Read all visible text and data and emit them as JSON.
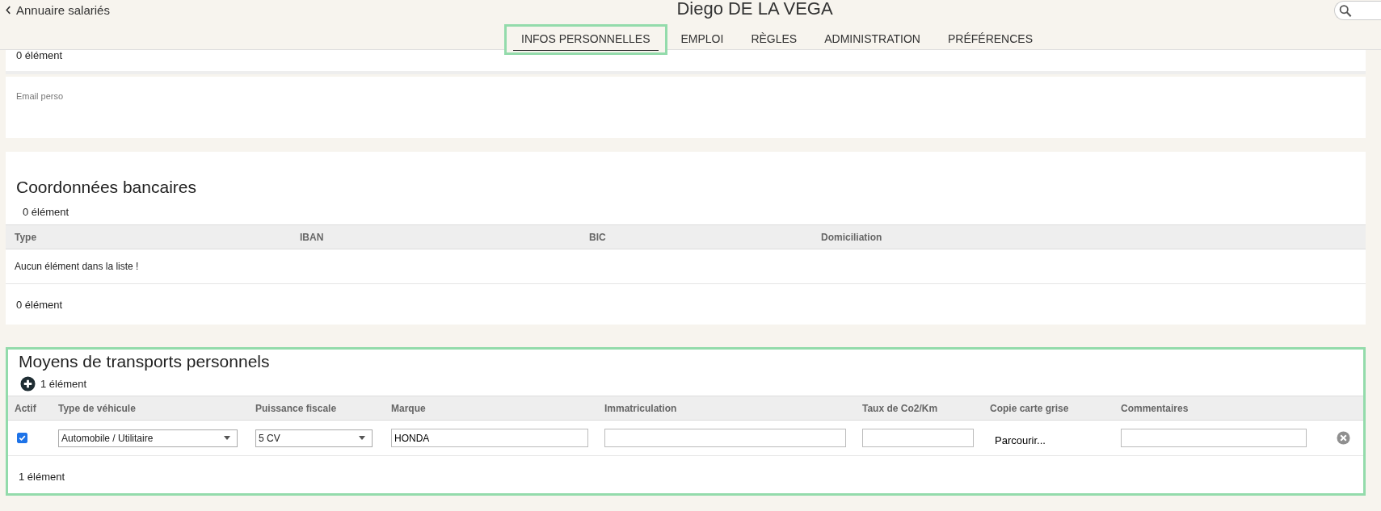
{
  "header": {
    "back_link": "Annuaire salariés",
    "title": "Diego DE LA VEGA"
  },
  "tabs": [
    {
      "label": "INFOS PERSONNELLES",
      "selected": true
    },
    {
      "label": "EMPLOI",
      "selected": false
    },
    {
      "label": "RÈGLES",
      "selected": false
    },
    {
      "label": "ADMINISTRATION",
      "selected": false
    },
    {
      "label": "PRÉFÉRENCES",
      "selected": false
    }
  ],
  "top_card": {
    "count": "0 élément"
  },
  "email_card": {
    "label": "Email perso"
  },
  "bank_section": {
    "title": "Coordonnées bancaires",
    "count": "0 élément",
    "columns": [
      "Type",
      "IBAN",
      "BIC",
      "Domiciliation"
    ],
    "empty_message": "Aucun élément dans la liste !",
    "footer_count": "0 élément"
  },
  "transport_section": {
    "title": "Moyens de transports personnels",
    "count": "1 élément",
    "columns": [
      "Actif",
      "Type de véhicule",
      "Puissance fiscale",
      "Marque",
      "Immatriculation",
      "Taux de Co2/Km",
      "Copie carte grise",
      "Commentaires"
    ],
    "rows": [
      {
        "active": true,
        "vehicle_type": "Automobile / Utilitaire",
        "fiscal_power": "5 CV",
        "brand": "HONDA",
        "registration": "",
        "co2_rate": "",
        "file_button": "Parcourir...",
        "comments": ""
      }
    ],
    "footer_count": "1 élément"
  }
}
